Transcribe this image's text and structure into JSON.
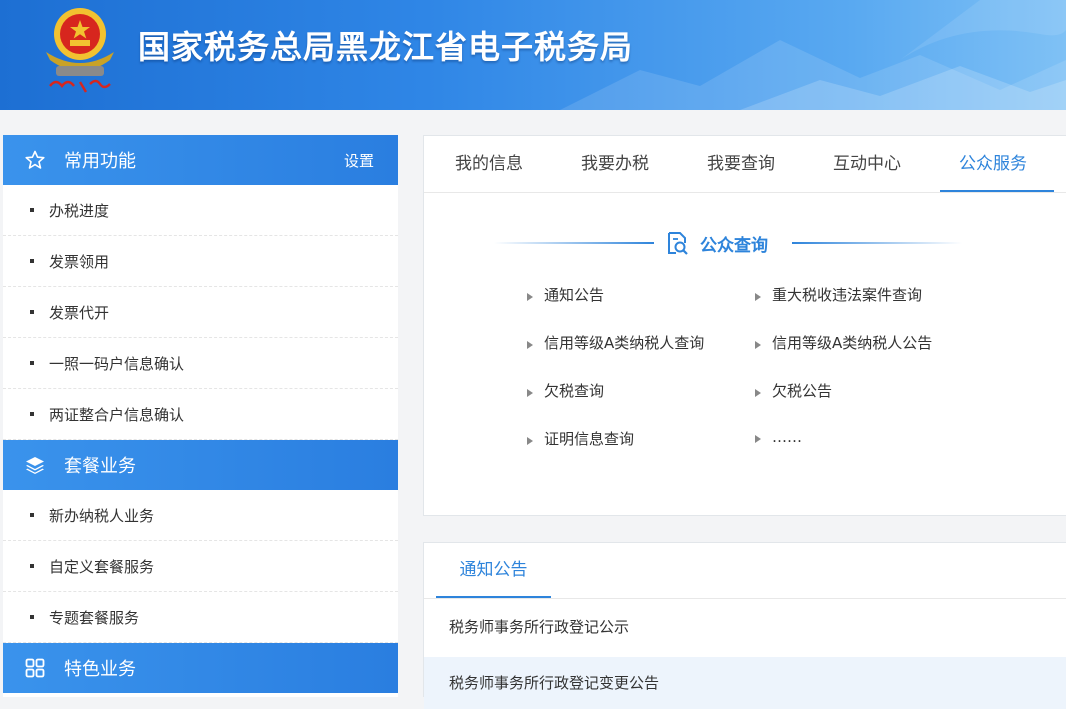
{
  "header": {
    "title": "国家税务总局黑龙江省电子税务局"
  },
  "colors": {
    "brand_blue": "#2e84db",
    "header_blue": "#1d6fd3",
    "sidebar_head": "#3a93ec",
    "emblem_red": "#d7261e",
    "emblem_gold": "#f2c230"
  },
  "sidebar": {
    "sections": [
      {
        "icon": "star-icon",
        "label": "常用功能",
        "setting": "设置",
        "items": [
          "办税进度",
          "发票领用",
          "发票代开",
          "一照一码户信息确认",
          "两证整合户信息确认"
        ]
      },
      {
        "icon": "layers-icon",
        "label": "套餐业务",
        "items": [
          "新办纳税人业务",
          "自定义套餐服务",
          "专题套餐服务"
        ]
      },
      {
        "icon": "grid-icon",
        "label": "特色业务",
        "items": []
      }
    ]
  },
  "main": {
    "tabs": [
      "我的信息",
      "我要办税",
      "我要查询",
      "互动中心",
      "公众服务"
    ],
    "active_tab": "公众服务",
    "section_title": "公众查询",
    "section_icon": "search-doc-icon",
    "links": [
      "通知公告",
      "重大税收违法案件查询",
      "信用等级A类纳税人查询",
      "信用等级A类纳税人公告",
      "欠税查询",
      "欠税公告",
      "证明信息查询",
      "……"
    ]
  },
  "notices": {
    "tab": "通知公告",
    "items": [
      "税务师事务所行政登记公示",
      "税务师事务所行政登记变更公告"
    ]
  }
}
